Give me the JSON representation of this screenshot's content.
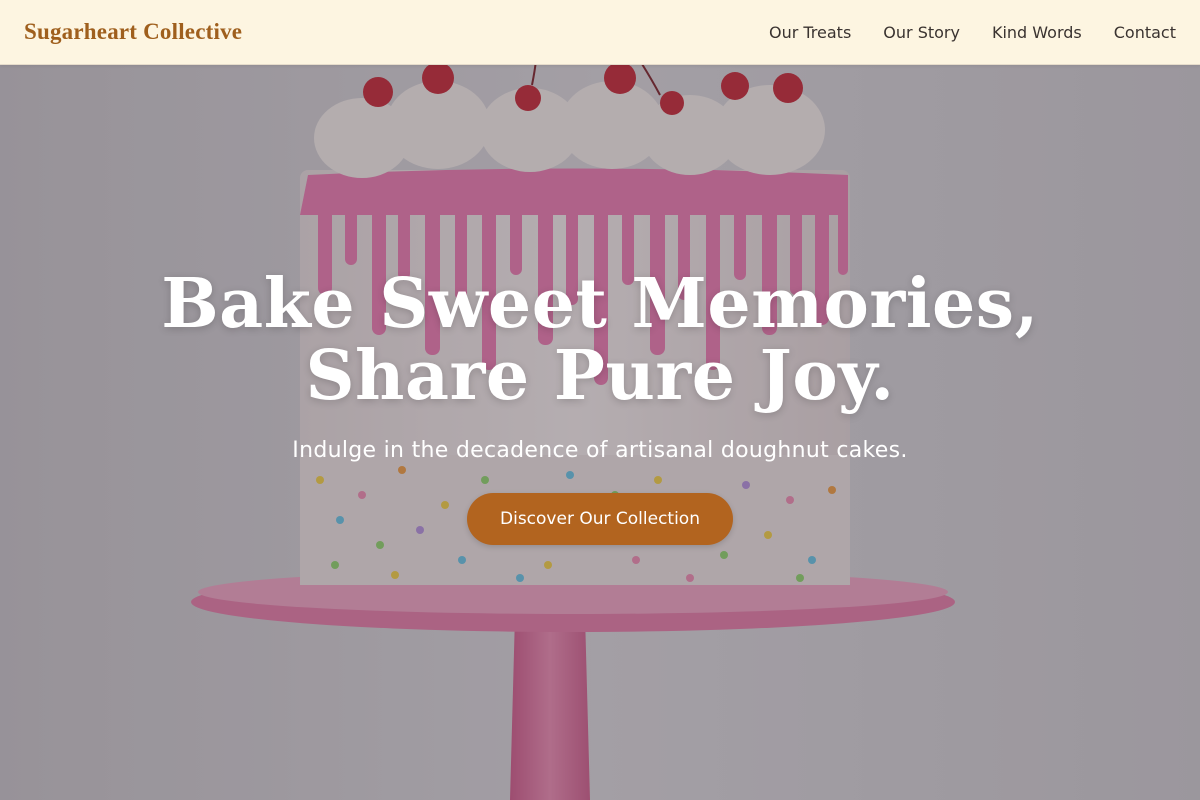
{
  "header": {
    "brand": "Sugarheart Collective",
    "nav": [
      "Our Treats",
      "Our Story",
      "Kind Words",
      "Contact"
    ]
  },
  "hero": {
    "headline_line1": "Bake Sweet Memories,",
    "headline_line2": "Share Pure Joy.",
    "subheadline": "Indulge in the decadence of artisanal doughnut cakes.",
    "cta_label": "Discover Our Collection",
    "background_image": "drip-cake-on-pink-stand"
  },
  "colors": {
    "header_bg": "#fdf5e1",
    "brand": "#9f5f1d",
    "cta_bg": "#b2641f",
    "headline": "#ffffff",
    "nav_text": "#3a3330"
  }
}
